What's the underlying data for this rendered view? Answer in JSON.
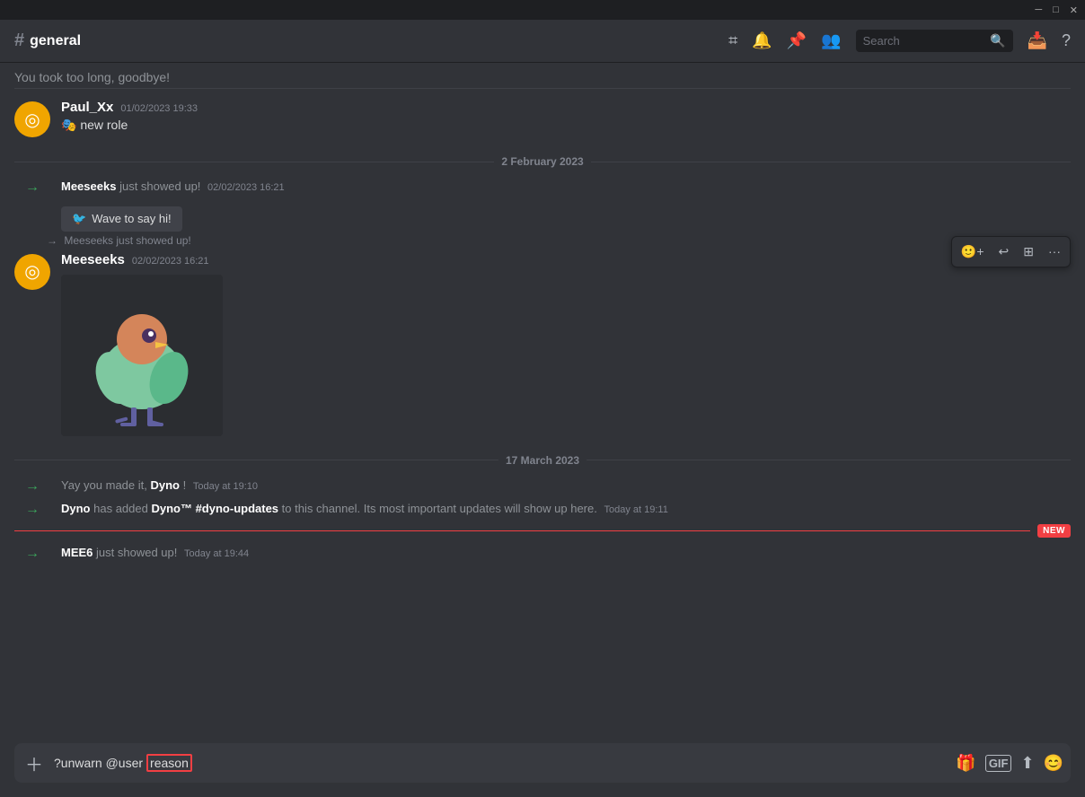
{
  "titlebar": {
    "minimize": "─",
    "maximize": "□",
    "close": "✕"
  },
  "header": {
    "channel_name": "general",
    "hash": "#",
    "icons": {
      "channel": "⌗",
      "bell": "🔔",
      "pin": "📌",
      "members": "👥",
      "search_placeholder": "Search",
      "inbox": "📥",
      "help": "?"
    }
  },
  "messages": {
    "top_message": "You took too long, goodbye!",
    "paul_author": "Paul_Xx",
    "paul_timestamp": "01/02/2023 19:33",
    "paul_text": "🎭 new role",
    "date1": "2 February 2023",
    "meeseeks_system1_text": "just showed up!",
    "meeseeks_system1_timestamp": "02/02/2023 16:21",
    "meeseeks_system1_author": "Meeseeks",
    "wave_btn": "Wave to say hi!",
    "meeseeks_ref": "→ Meeseeks just showed up!",
    "meeseeks_author": "Meeseeks",
    "meeseeks_timestamp": "02/02/2023 16:21",
    "date2": "17 March 2023",
    "dyno_system1_text": "Yay you made it,",
    "dyno_system1_bold": "Dyno",
    "dyno_system1_timestamp": "Today at 19:10",
    "dyno_system2_author": "Dyno",
    "dyno_system2_text": "has added",
    "dyno_system2_bold1": "Dyno™ #dyno-updates",
    "dyno_system2_text2": "to this channel. Its most important updates will",
    "dyno_system2_text3": "show up here.",
    "dyno_system2_timestamp": "Today at 19:11",
    "mee6_author": "MEE6",
    "mee6_text": "just showed up!",
    "mee6_timestamp": "Today at 19:44",
    "new_badge": "NEW"
  },
  "hover_actions": {
    "emoji": "🙂",
    "reply": "↩",
    "add": "⊞",
    "more": "…"
  },
  "input": {
    "prefix": "?unwarn @user",
    "cursor_text": "reason",
    "icons": {
      "gift": "🎁",
      "gif": "GIF",
      "upload": "⬆",
      "emoji": "😊"
    }
  }
}
